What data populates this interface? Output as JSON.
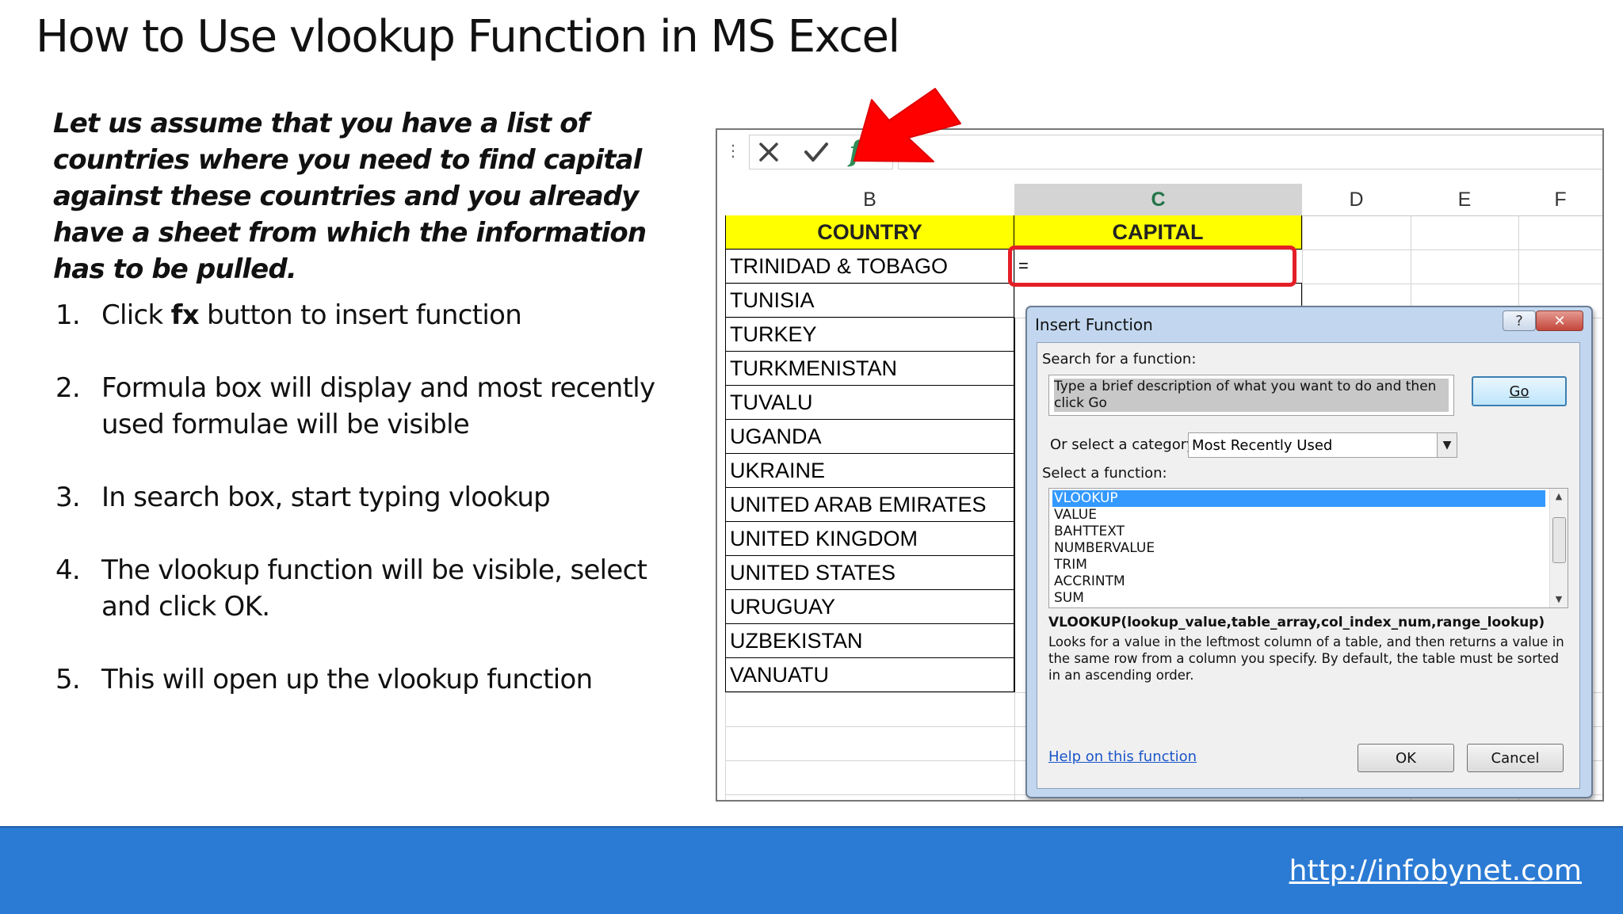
{
  "title": "How to Use vlookup Function in MS Excel",
  "intro": "Let us assume that you have a list of countries where you need to find capital against these countries and you already have a sheet from which the information has to be pulled.",
  "steps": [
    {
      "num": "1.",
      "pre": "Click ",
      "bold": "fx",
      "post": " button to insert function"
    },
    {
      "num": "2.",
      "text": "Formula box will display and most recently used formulae will be visible"
    },
    {
      "num": "3.",
      "text": "In search box, start typing vlookup"
    },
    {
      "num": "4.",
      "text": "The vlookup function will be visible, select and click OK."
    },
    {
      "num": "5.",
      "text": "This will open up the vlookup function"
    }
  ],
  "excel": {
    "formula_buttons": {
      "cancel_icon": "✕",
      "enter_icon": "✓",
      "fx": "fx"
    },
    "columns": [
      "B",
      "C",
      "D",
      "E",
      "F"
    ],
    "selected_column": "C",
    "header_row": {
      "country": "COUNTRY",
      "capital": "CAPITAL"
    },
    "active_cell_value": "=",
    "countries": [
      "TRINIDAD & TOBAGO",
      "TUNISIA",
      "TURKEY",
      "TURKMENISTAN",
      "TUVALU",
      "UGANDA",
      "UKRAINE",
      "UNITED ARAB EMIRATES",
      "UNITED KINGDOM",
      "UNITED STATES",
      "URUGUAY",
      "UZBEKISTAN",
      "VANUATU"
    ]
  },
  "dialog": {
    "title": "Insert Function",
    "help_button": "?",
    "close_button": "✕",
    "search_label": "Search for a function:",
    "search_value": "Type a brief description of what you want to do and then click Go",
    "go_button": "Go",
    "category_label": "Or select a category:",
    "category_value": "Most Recently Used",
    "select_label": "Select a function:",
    "functions": [
      "VLOOKUP",
      "VALUE",
      "BAHTTEXT",
      "NUMBERVALUE",
      "TRIM",
      "ACCRINTM",
      "SUM"
    ],
    "selected_function": "VLOOKUP",
    "signature": "VLOOKUP(lookup_value,table_array,col_index_num,range_lookup)",
    "description": "Looks for a value in the leftmost column of a table, and then returns a value in the same row from a column you specify. By default, the table must be sorted in an ascending order.",
    "help_link": "Help on this function",
    "ok_button": "OK",
    "cancel_button": "Cancel"
  },
  "colors": {
    "accent_red": "#e41e26",
    "header_yellow": "#ffff00",
    "footer_blue": "#2b7bd4",
    "excel_green": "#217346"
  },
  "footer_url": "http://infobynet.com"
}
